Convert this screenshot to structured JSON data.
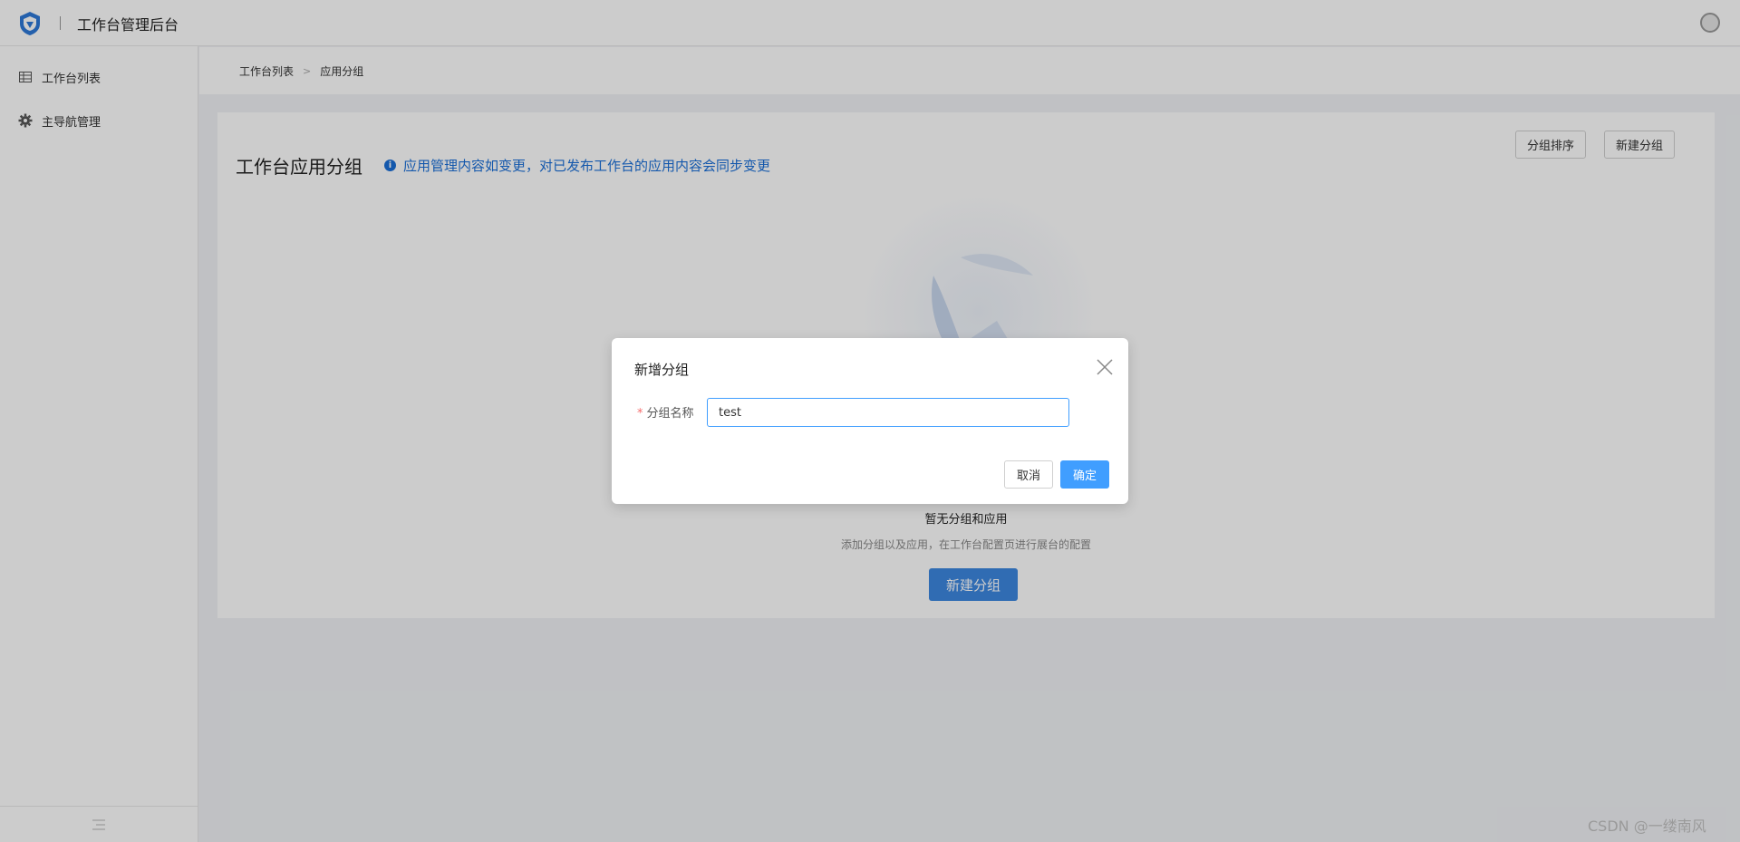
{
  "header": {
    "app_title": "工作台管理后台",
    "brand_color": "#2d78d8"
  },
  "sidebar": {
    "items": [
      {
        "label": "工作台列表",
        "icon": "table-icon"
      },
      {
        "label": "主导航管理",
        "icon": "gear-icon"
      }
    ],
    "collapse_icon": "collapse-icon"
  },
  "breadcrumb": {
    "items": [
      "工作台列表",
      "应用分组"
    ]
  },
  "main": {
    "title": "工作台应用分组",
    "notice": "应用管理内容如变更，对已发布工作台的应用内容会同步变更",
    "sort_button": "分组排序",
    "new_button": "新建分组",
    "empty": {
      "title": "暂无分组和应用",
      "subtitle": "添加分组以及应用，在工作台配置页进行展台的配置",
      "button": "新建分组"
    }
  },
  "dialog": {
    "title": "新增分组",
    "field_label": "分组名称",
    "field_required": "*",
    "field_value": "test",
    "cancel": "取消",
    "confirm": "确定"
  },
  "watermark": "CSDN @一缕南风"
}
